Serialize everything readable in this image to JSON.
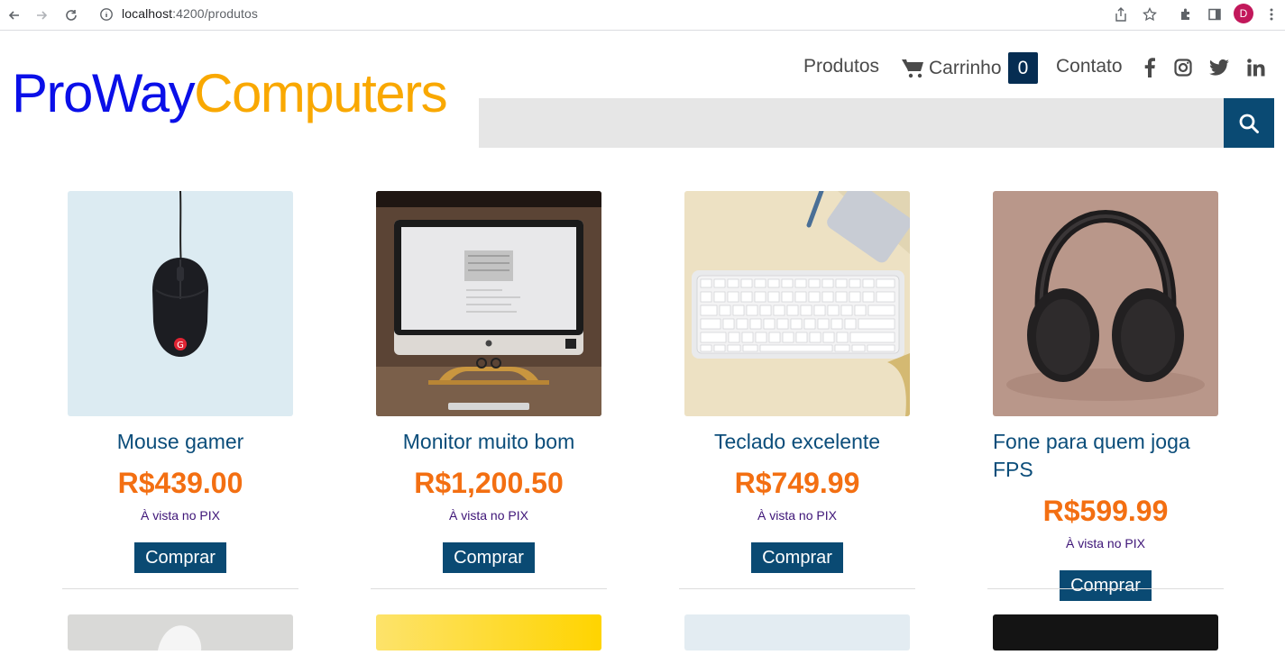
{
  "browser": {
    "url_host": "localhost",
    "url_path": ":4200/produtos",
    "avatar_letter": "D"
  },
  "header": {
    "logo_part1": "ProWay",
    "logo_part2": "Computers",
    "nav": {
      "produtos": "Produtos",
      "carrinho": "Carrinho",
      "cart_count": "0",
      "contato": "Contato"
    },
    "search": {
      "placeholder": ""
    }
  },
  "products": [
    {
      "name": "Mouse gamer",
      "price": "R$439.00",
      "payment": "À vista no PIX",
      "buy_label": "Comprar",
      "image": "mouse"
    },
    {
      "name": "Monitor muito bom",
      "price": "R$1,200.50",
      "payment": "À vista no PIX",
      "buy_label": "Comprar",
      "image": "monitor"
    },
    {
      "name": "Teclado excelente",
      "price": "R$749.99",
      "payment": "À vista no PIX",
      "buy_label": "Comprar",
      "image": "keyboard"
    },
    {
      "name": "Fone para quem joga FPS",
      "price": "R$599.99",
      "payment": "À vista no PIX",
      "buy_label": "Comprar",
      "image": "headphones"
    }
  ],
  "colors": {
    "brand_blue": "#0a0fe8",
    "brand_yellow": "#f9a800",
    "primary": "#0a4a73",
    "price": "#f36f12",
    "badge": "#062d52"
  }
}
